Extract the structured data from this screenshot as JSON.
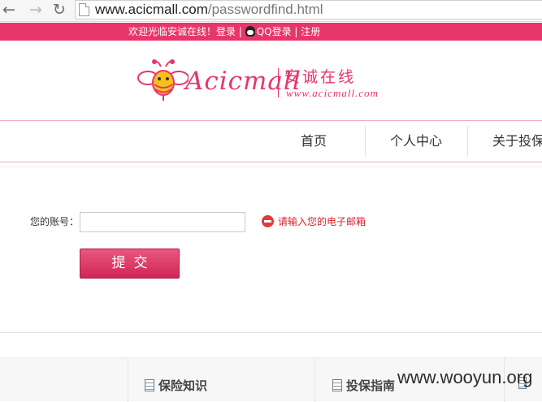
{
  "browser": {
    "url_host": "www.acicmall.com",
    "url_path": "/passwordfind.html"
  },
  "topbar": {
    "welcome": "欢迎光临安诚在线！",
    "login": "登录",
    "sep1": " | ",
    "qq_login": "QQ登录",
    "sep2": " | ",
    "register": "注册"
  },
  "logo": {
    "wordmark": "Acicmall",
    "cn_name": "安诚在线",
    "url": "www.acicmall.com"
  },
  "nav": {
    "items": [
      {
        "label": "首页"
      },
      {
        "label": "个人中心"
      },
      {
        "label": "关于投保"
      }
    ]
  },
  "form": {
    "account_label": "您的账号：",
    "account_value": "",
    "error_text": "请输入您的电子邮箱",
    "submit_label": "提交"
  },
  "footer": {
    "cols": [
      {
        "title": "保险知识"
      },
      {
        "title": "投保指南"
      }
    ],
    "watermark": "www.wooyun.org"
  },
  "colors": {
    "brand_pink": "#e8356b",
    "error_red": "#d8222f"
  }
}
